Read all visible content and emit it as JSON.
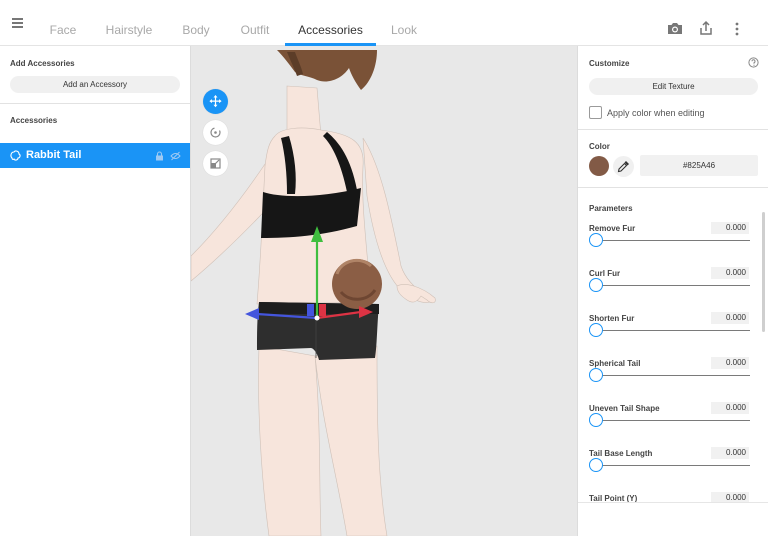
{
  "header": {
    "tabs": [
      {
        "label": "Face"
      },
      {
        "label": "Hairstyle"
      },
      {
        "label": "Body"
      },
      {
        "label": "Outfit"
      },
      {
        "label": "Accessories"
      },
      {
        "label": "Look"
      }
    ],
    "active_tab": "Accessories"
  },
  "left_panel": {
    "add_section_label": "Add Accessories",
    "add_button_label": "Add an Accessory",
    "accessories_label": "Accessories",
    "items": [
      {
        "name": "Rabbit Tail",
        "selected": true
      }
    ]
  },
  "right_panel": {
    "customize_label": "Customize",
    "edit_texture_label": "Edit Texture",
    "apply_color_label": "Apply color when editing",
    "apply_color_checked": false,
    "color_label": "Color",
    "color_hex": "#825A46",
    "parameters_label": "Parameters",
    "parameters": [
      {
        "name": "Remove Fur",
        "value": "0.000",
        "fraction": 0
      },
      {
        "name": "Curl Fur",
        "value": "0.000",
        "fraction": 0
      },
      {
        "name": "Shorten Fur",
        "value": "0.000",
        "fraction": 0
      },
      {
        "name": "Spherical Tail",
        "value": "0.000",
        "fraction": 0
      },
      {
        "name": "Uneven Tail Shape",
        "value": "0.000",
        "fraction": 0
      },
      {
        "name": "Tail Base Length",
        "value": "0.000",
        "fraction": 0
      },
      {
        "name": "Tail Point (Y)",
        "value": "0.000",
        "fraction": 0
      }
    ]
  },
  "colors": {
    "accent": "#1a94f6",
    "tail_color": "#825A46"
  },
  "icons": {
    "menu": "menu-icon",
    "camera": "camera-icon",
    "export": "export-icon",
    "more": "more-vertical-icon",
    "move_tool": "move-tool-icon",
    "rotate_tool": "rotate-tool-icon",
    "scale_tool": "scale-tool-icon",
    "help": "help-icon",
    "eyedropper": "eyedropper-icon",
    "lock": "lock-icon",
    "visibility": "visibility-icon"
  }
}
